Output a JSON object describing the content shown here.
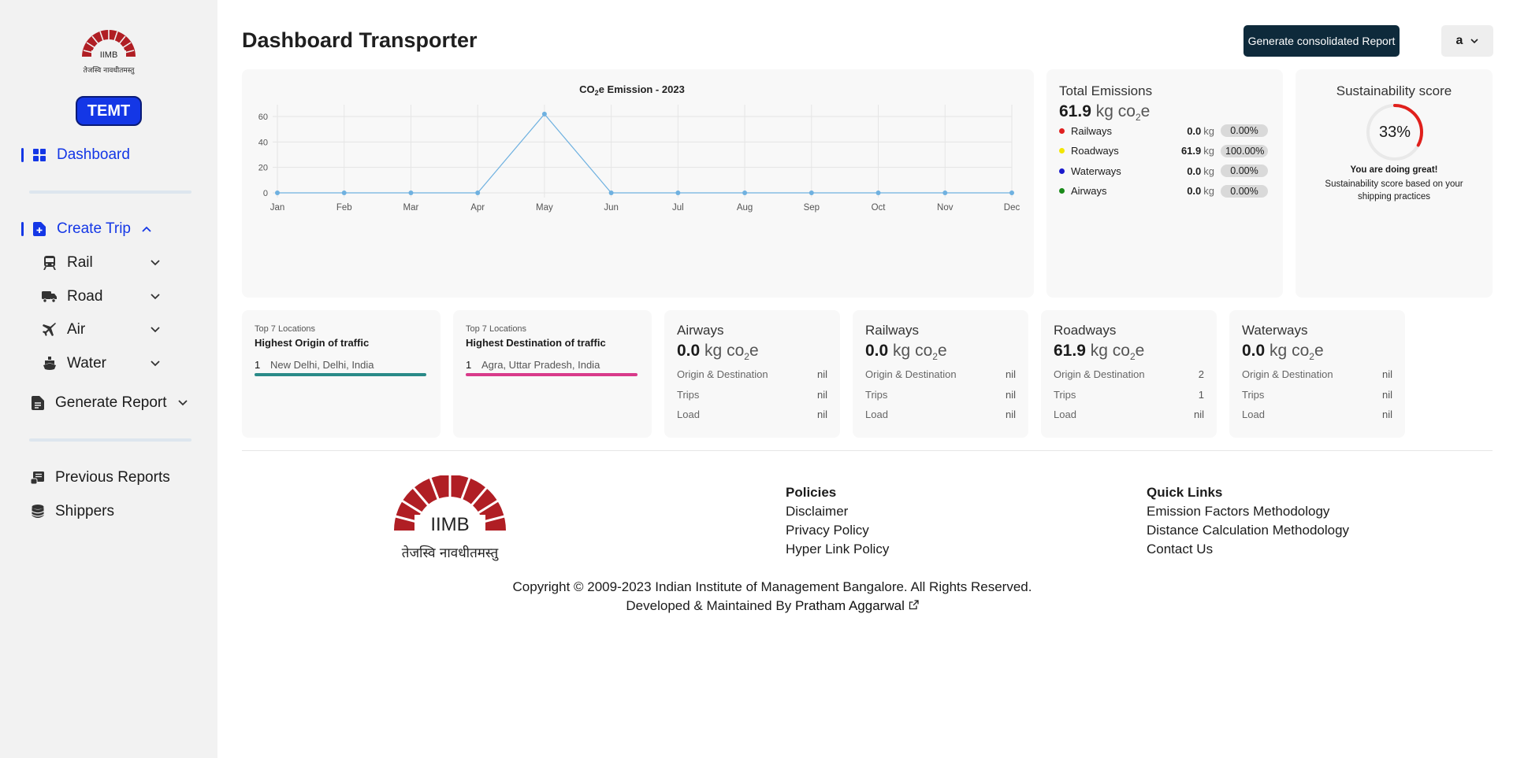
{
  "sidebar": {
    "logo_text": "IIMB",
    "logo_tagline": "तेजस्वि नावधीतमस्तु",
    "badge": "TEMT",
    "dashboard": "Dashboard",
    "create_trip": "Create Trip",
    "sub_items": [
      {
        "label": "Rail",
        "icon": "train-icon"
      },
      {
        "label": "Road",
        "icon": "truck-icon"
      },
      {
        "label": "Air",
        "icon": "plane-icon"
      },
      {
        "label": "Water",
        "icon": "ship-icon"
      }
    ],
    "generate_report": "Generate Report",
    "previous_reports": "Previous Reports",
    "shippers": "Shippers",
    "accent_color": "#1437e6"
  },
  "header": {
    "title": "Dashboard Transporter",
    "generate_button": "Generate consolidated Report",
    "user_initial": "a"
  },
  "chart_data": {
    "type": "line",
    "title_prefix": "CO",
    "title_sub": "2",
    "title_suffix": "e Emission - 2023",
    "categories": [
      "Jan",
      "Feb",
      "Mar",
      "Apr",
      "May",
      "Jun",
      "Jul",
      "Aug",
      "Sep",
      "Oct",
      "Nov",
      "Dec"
    ],
    "values": [
      0,
      0,
      0,
      0,
      61.9,
      0,
      0,
      0,
      0,
      0,
      0,
      0
    ],
    "yticks": [
      0,
      20,
      40,
      60
    ],
    "ylim": [
      0,
      70
    ],
    "grid": true,
    "line_color": "#6fb1e0"
  },
  "total_emissions": {
    "title": "Total Emissions",
    "value": "61.9",
    "unit": "kg",
    "co2_prefix": "co",
    "co2_sub": "2",
    "co2_suffix": "e",
    "rows": [
      {
        "name": "Railways",
        "value": "0.0",
        "unit": "kg",
        "pct": "0.00%",
        "color": "#e02020"
      },
      {
        "name": "Roadways",
        "value": "61.9",
        "unit": "kg",
        "pct": "100.00%",
        "color": "#f2e600"
      },
      {
        "name": "Waterways",
        "value": "0.0",
        "unit": "kg",
        "pct": "0.00%",
        "color": "#1a1acc"
      },
      {
        "name": "Airways",
        "value": "0.0",
        "unit": "kg",
        "pct": "0.00%",
        "color": "#1a8a1a"
      }
    ]
  },
  "sustainability": {
    "title": "Sustainability score",
    "percent_text": "33%",
    "percent_value": 33,
    "message": "You are doing great!",
    "description": "Sustainability score based on your shipping practices",
    "gauge_color": "#e0201c"
  },
  "locations": [
    {
      "small": "Top 7 Locations",
      "title": "Highest Origin of traffic",
      "rank": "1",
      "place": "New Delhi, Delhi, India",
      "color": "#2a8a88"
    },
    {
      "small": "Top 7 Locations",
      "title": "Highest Destination of traffic",
      "rank": "1",
      "place": "Agra, Uttar Pradesh, India",
      "color": "#d83a8a"
    }
  ],
  "modes": [
    {
      "title": "Airways",
      "value": "0.0",
      "od": "nil",
      "trips": "nil",
      "load": "nil"
    },
    {
      "title": "Railways",
      "value": "0.0",
      "od": "nil",
      "trips": "nil",
      "load": "nil"
    },
    {
      "title": "Roadways",
      "value": "61.9",
      "od": "2",
      "trips": "1",
      "load": "nil"
    },
    {
      "title": "Waterways",
      "value": "0.0",
      "od": "nil",
      "trips": "nil",
      "load": "nil"
    }
  ],
  "mode_labels": {
    "unit": "kg",
    "co2_prefix": "co",
    "co2_sub": "2",
    "co2_suffix": "e",
    "od": "Origin & Destination",
    "trips": "Trips",
    "load": "Load"
  },
  "footer": {
    "policies_title": "Policies",
    "policies": [
      "Disclaimer",
      "Privacy Policy",
      "Hyper Link Policy"
    ],
    "quick_title": "Quick Links",
    "quick": [
      "Emission Factors Methodology",
      "Distance Calculation Methodology",
      "Contact Us"
    ],
    "copyright": "Copyright © 2009-2023 Indian Institute of Management Bangalore. All Rights Reserved.",
    "developed_prefix": "Developed & Maintained By",
    "developer": "Pratham Aggarwal"
  }
}
